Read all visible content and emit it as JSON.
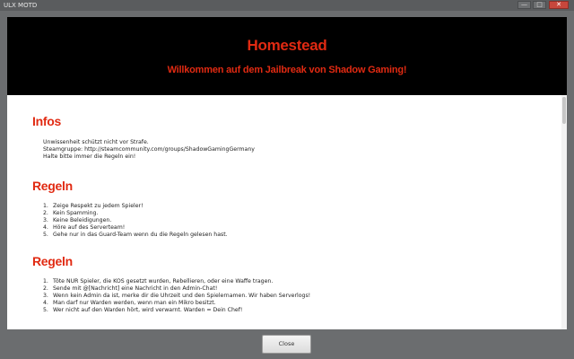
{
  "window": {
    "title": "ULX MOTD",
    "minimize_glyph": "—",
    "maximize_glyph": "□",
    "close_glyph": "✕"
  },
  "banner": {
    "title": "Homestead",
    "subtitle": "Willkommen auf dem Jailbreak von Shadow Gaming!"
  },
  "sections": {
    "infos": {
      "heading": "Infos",
      "lines": [
        "Unwissenheit schützt nicht vor Strafe.",
        "Steamgruppe: http://steamcommunity.com/groups/ShadowGamingGermany",
        "Halte bitte immer die Regeln ein!"
      ]
    },
    "regeln1": {
      "heading": "Regeln",
      "items": [
        "Zeige Respekt zu jedem Spieler!",
        "Kein Spamming.",
        "Keine Beleidigungen.",
        "Höre auf des Serverteam!",
        "Gehe nur in das Guard-Team wenn du die Regeln gelesen hast."
      ]
    },
    "regeln2": {
      "heading": "Regeln",
      "items": [
        "Töte NUR Spieler, die KOS gesetzt wurden, Rebellieren, oder eine Waffe tragen.",
        "Sende mit @[Nachricht] eine Nachricht in den Admin-Chat!",
        "Wenn kein Admin da ist, merke dir die Uhrzeit und den Spielernamen. Wir haben Serverlogs!",
        "Man darf nur Warden werden, wenn man ein Mikro besitzt.",
        "Wer nicht auf den Warden hört, wird verwarnt. Warden = Dein Chef!"
      ]
    }
  },
  "footer": {
    "close_label": "Close"
  },
  "colors": {
    "accent_red": "#e12a12",
    "banner_bg": "#000000",
    "frame_bg": "#6b6d6f"
  }
}
